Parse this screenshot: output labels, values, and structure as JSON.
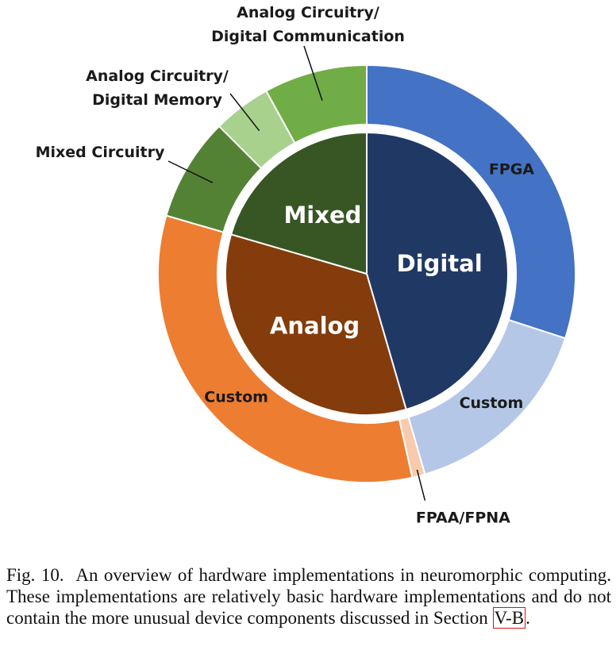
{
  "chart_data": {
    "type": "pie",
    "style": "nested-donut",
    "inner_ring": [
      {
        "label": "Digital",
        "value": 45.5,
        "color": "#203864"
      },
      {
        "label": "Analog",
        "value": 34.0,
        "color": "#843c0c"
      },
      {
        "label": "Mixed",
        "value": 20.5,
        "color": "#375623"
      }
    ],
    "outer_ring": [
      {
        "label": "FPGA",
        "value": 30.0,
        "color": "#4472c4",
        "group": "Digital"
      },
      {
        "label": "Custom",
        "value": 15.5,
        "color": "#b4c7e7",
        "group": "Digital"
      },
      {
        "label": "FPAA/FPNA",
        "value": 1.0,
        "color": "#f8cbad",
        "group": "Analog"
      },
      {
        "label": "Custom",
        "value": 33.0,
        "color": "#ed7d31",
        "group": "Analog"
      },
      {
        "label": "Mixed Circuitry",
        "value": 8.0,
        "color": "#548235",
        "group": "Mixed"
      },
      {
        "label": "Analog Circuitry/ Digital Memory",
        "value": 4.5,
        "color": "#a9d18e",
        "group": "Mixed"
      },
      {
        "label": "Analog Circuitry/ Digital Communication",
        "value": 8.0,
        "color": "#70ad47",
        "group": "Mixed"
      }
    ]
  },
  "caption": {
    "prefix": "Fig. 10.  An overview of hardware implementations in neuromorphic computing. These implementations are relatively basic hardware implementations and do not contain the more unusual device components discussed in Section ",
    "ref": "V-B",
    "suffix": "."
  }
}
